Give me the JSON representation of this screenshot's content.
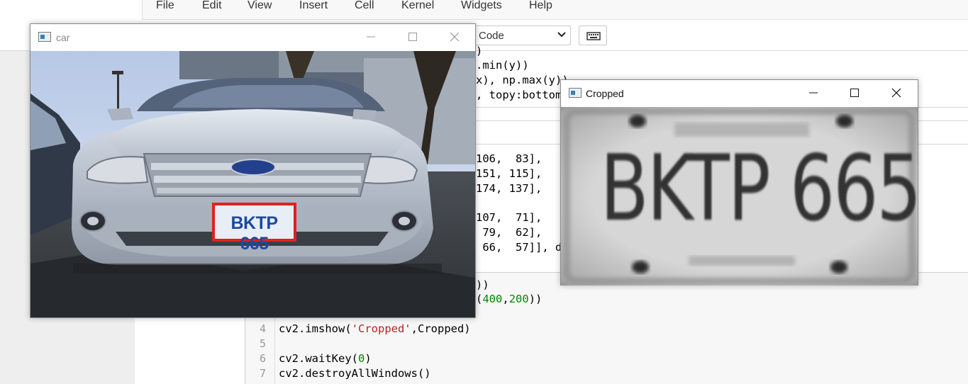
{
  "menubar": {
    "items": [
      {
        "label": "File"
      },
      {
        "label": "Edit"
      },
      {
        "label": "View"
      },
      {
        "label": "Insert"
      },
      {
        "label": "Cell"
      },
      {
        "label": "Kernel"
      },
      {
        "label": "Widgets"
      },
      {
        "label": "Help"
      }
    ]
  },
  "toolbar": {
    "cell_type": "Code"
  },
  "notebook": {
    "partial_lines": [
      ")",
      ".min(y))",
      "x), np.max(y))",
      ", topy:bottom",
      "106,  83],",
      "151, 115],",
      "174, 137],",
      "107,  71],",
      " 79,  62],",
      " 66,  57]], d",
      "))",
      "))"
    ],
    "code_cell": {
      "line_numbers": [
        "4",
        "5",
        "6",
        "7"
      ],
      "line4": "cv2.imshow('Cropped',Cropped)",
      "line4_pre": "cv2.imshow(",
      "line4_str": "'Cropped'",
      "line4_post": ",Cropped)",
      "line6_pre": "cv2.waitKey(",
      "line6_num": "0",
      "line6_post": ")",
      "line7": "cv2.destroyAllWindows()",
      "resize_pre": "(",
      "resize_num1": "400",
      "resize_comma": ",",
      "resize_num2": "200",
      "resize_post": "))"
    }
  },
  "windows": {
    "car": {
      "title": "car",
      "plate_text": "BKTP 665"
    },
    "cropped": {
      "title": "Cropped",
      "plate_text": "BKTP 665"
    }
  },
  "colors": {
    "plate_box": "#e02020",
    "string": "#ba2121",
    "number": "#008800"
  }
}
